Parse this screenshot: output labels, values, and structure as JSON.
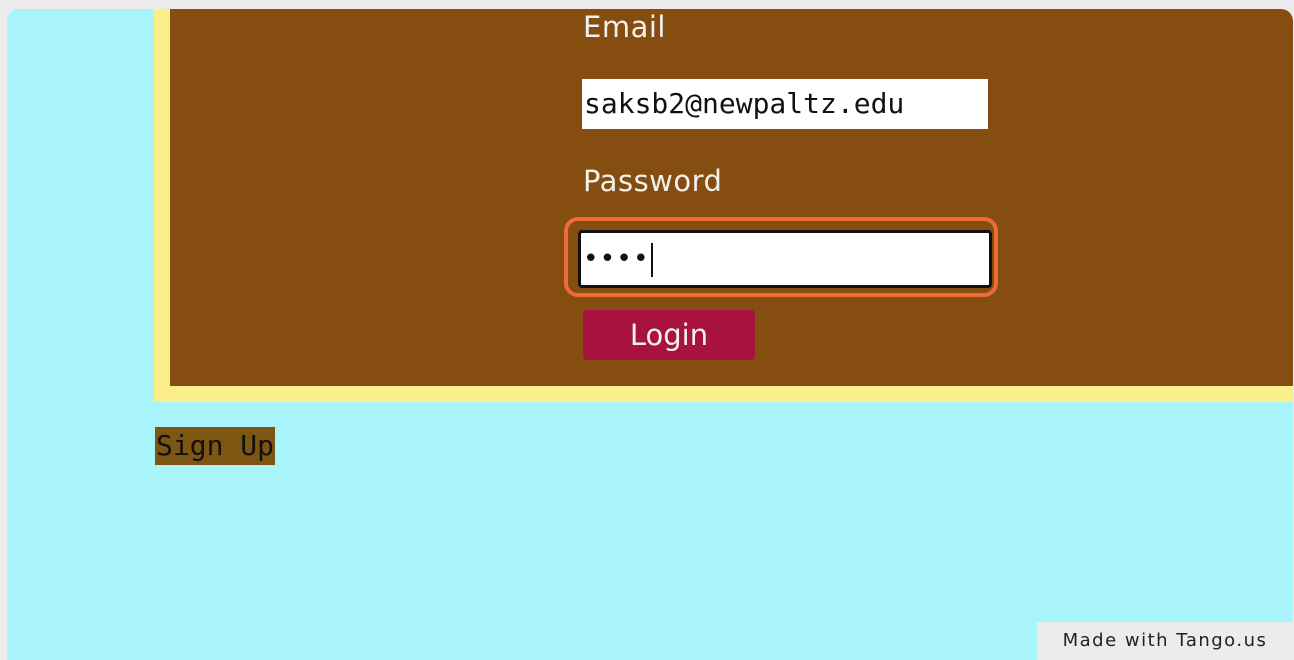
{
  "form": {
    "email_label": "Email",
    "email_value": "saksb2@newpaltz.edu",
    "password_label": "Password",
    "password_masked": "••••",
    "login_label": "Login"
  },
  "links": {
    "signup_label": "Sign Up"
  },
  "watermark": {
    "text": "Made with Tango.us"
  },
  "colors": {
    "page_background": "#a8f4fa",
    "panel_background": "#864d10",
    "panel_border": "#fbef8c",
    "login_button": "#a8123e",
    "focus_highlight": "#ee6a3a",
    "signup_background": "#7d5611"
  }
}
